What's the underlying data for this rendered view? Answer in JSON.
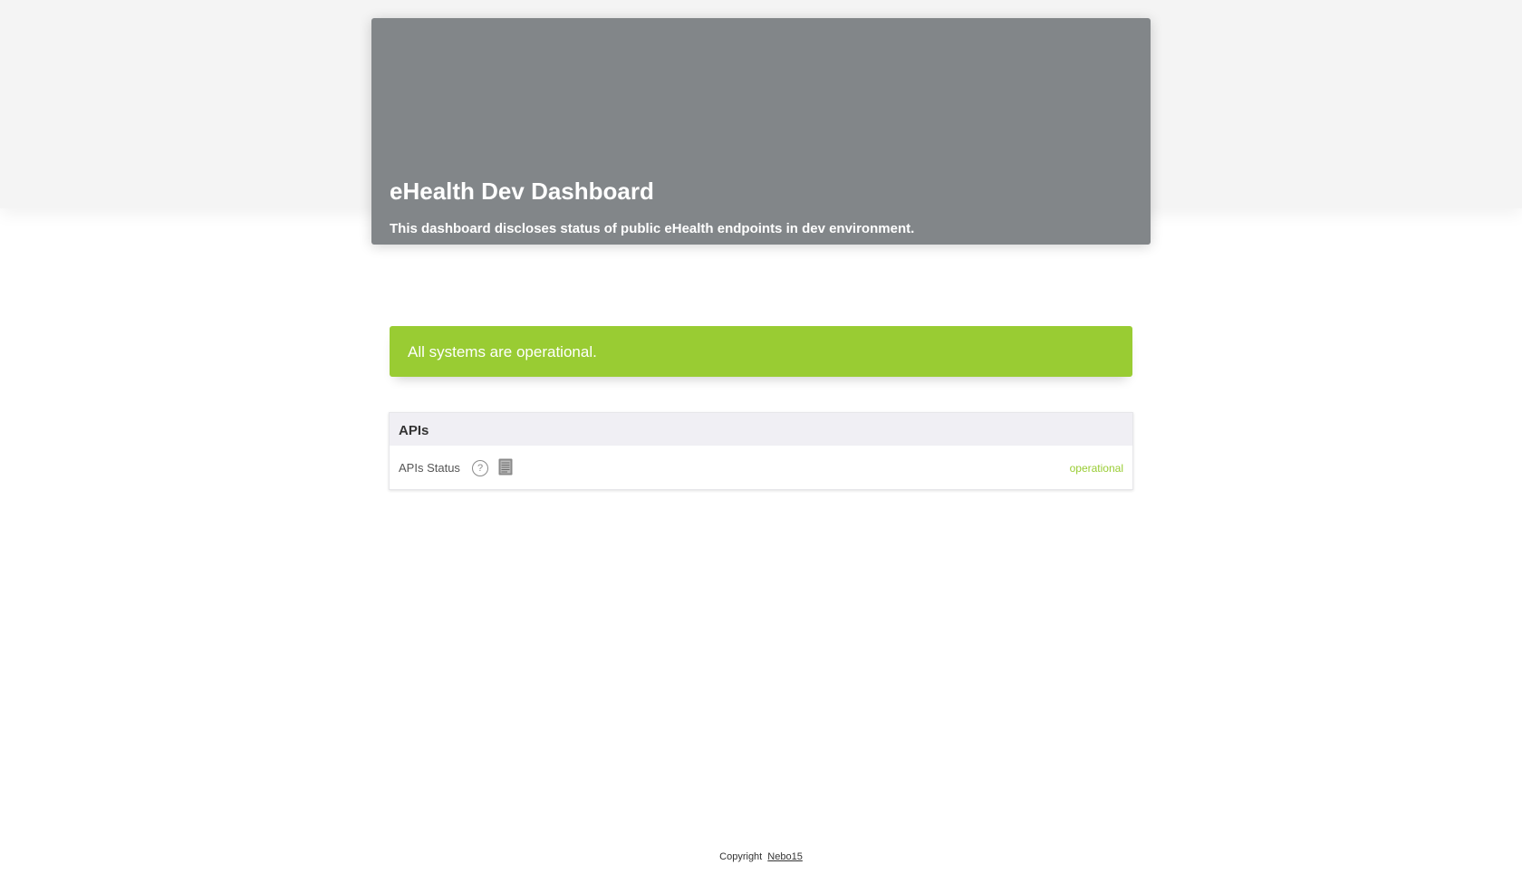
{
  "colors": {
    "hero_background": "#828689",
    "status_green": "#99cc33",
    "operational_text": "#99cc33"
  },
  "header": {
    "title": "eHealth Dev Dashboard",
    "subtitle": "This dashboard discloses status of public eHealth endpoints in dev environment."
  },
  "status_banner": {
    "text": "All systems are operational."
  },
  "groups": [
    {
      "name": "APIs",
      "components": [
        {
          "name": "APIs Status",
          "status": "operational",
          "icons": [
            "help-icon",
            "document-icon"
          ]
        }
      ]
    }
  ],
  "footer": {
    "prefix": "Copyright",
    "link_text": "Nebo15"
  }
}
